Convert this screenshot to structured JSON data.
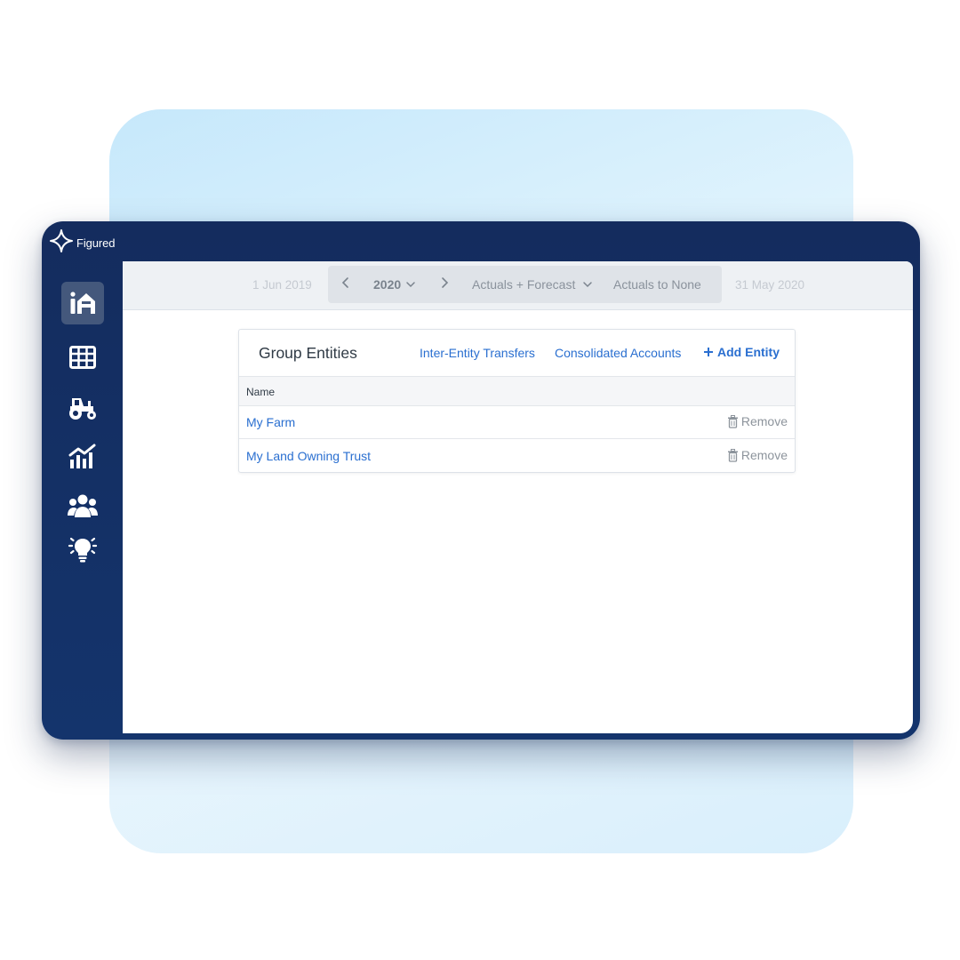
{
  "app": {
    "name": "Figured"
  },
  "sidebar": {
    "items": [
      {
        "id": "farm",
        "icon": "farm-barn-icon",
        "active": true
      },
      {
        "id": "grid",
        "icon": "table-grid-icon",
        "active": false
      },
      {
        "id": "tractor",
        "icon": "tractor-icon",
        "active": false
      },
      {
        "id": "reports",
        "icon": "chart-trend-icon",
        "active": false
      },
      {
        "id": "people",
        "icon": "users-group-icon",
        "active": false
      },
      {
        "id": "ideas",
        "icon": "lightbulb-icon",
        "active": false
      }
    ]
  },
  "period": {
    "start_date": "1 Jun 2019",
    "end_date": "31 May 2020",
    "year": "2020",
    "mode": "Actuals + Forecast",
    "compare": "Actuals to None"
  },
  "group_entities": {
    "title": "Group Entities",
    "links": {
      "transfers": "Inter-Entity Transfers",
      "consolidated": "Consolidated Accounts",
      "add": "Add Entity"
    },
    "column_name": "Name",
    "rows": [
      {
        "name": "My Farm",
        "action": "Remove"
      },
      {
        "name": "My Land Owning Trust",
        "action": "Remove"
      }
    ]
  },
  "colors": {
    "sidebar_bg": "#142c5e",
    "link": "#2a6fd0",
    "bg_card": "#d6eefc"
  }
}
